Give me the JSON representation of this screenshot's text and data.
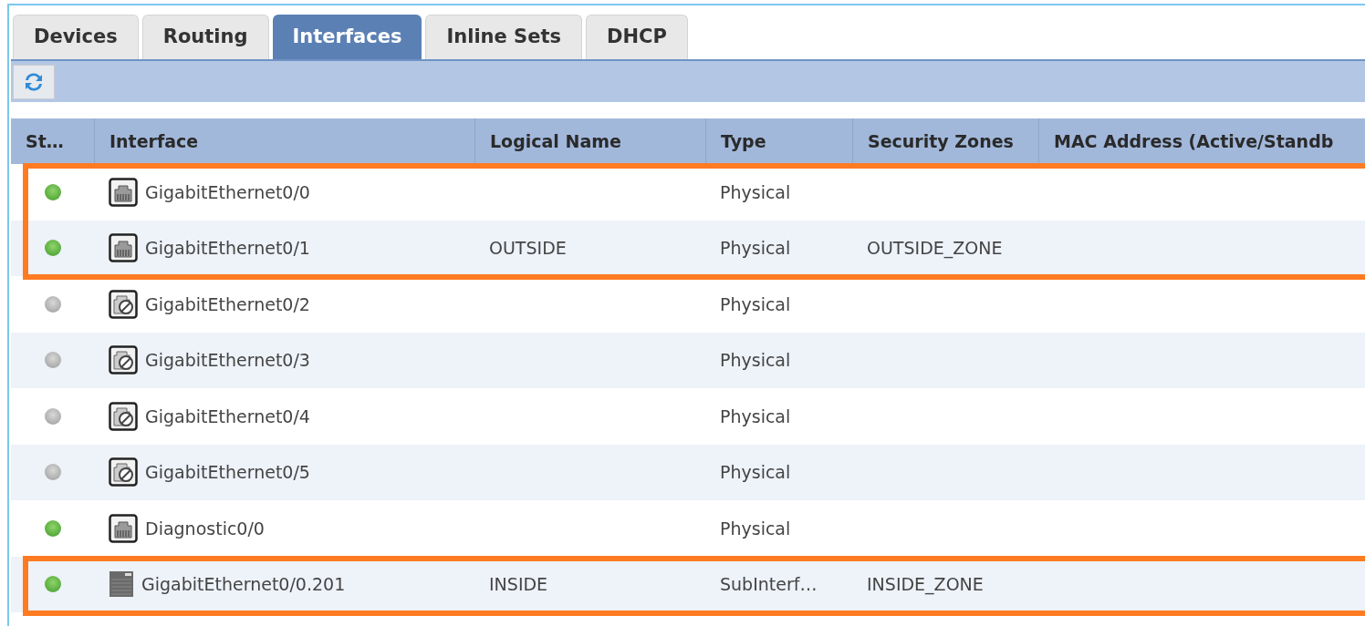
{
  "tabs": [
    {
      "label": "Devices",
      "selected": false
    },
    {
      "label": "Routing",
      "selected": false
    },
    {
      "label": "Interfaces",
      "selected": true
    },
    {
      "label": "Inline Sets",
      "selected": false
    },
    {
      "label": "DHCP",
      "selected": false
    }
  ],
  "table": {
    "columns": [
      "St…",
      "Interface",
      "Logical Name",
      "Type",
      "Security Zones",
      "MAC Address (Active/Standb"
    ],
    "rows": [
      {
        "up": true,
        "kind": "port",
        "interface": "GigabitEthernet0/0",
        "logical_name": "",
        "type": "Physical",
        "security_zone": "",
        "highlighted": true
      },
      {
        "up": true,
        "kind": "port",
        "interface": "GigabitEthernet0/1",
        "logical_name": "OUTSIDE",
        "type": "Physical",
        "security_zone": "OUTSIDE_ZONE",
        "highlighted": true
      },
      {
        "up": false,
        "kind": "disabled-port",
        "interface": "GigabitEthernet0/2",
        "logical_name": "",
        "type": "Physical",
        "security_zone": "",
        "highlighted": false
      },
      {
        "up": false,
        "kind": "disabled-port",
        "interface": "GigabitEthernet0/3",
        "logical_name": "",
        "type": "Physical",
        "security_zone": "",
        "highlighted": false
      },
      {
        "up": false,
        "kind": "disabled-port",
        "interface": "GigabitEthernet0/4",
        "logical_name": "",
        "type": "Physical",
        "security_zone": "",
        "highlighted": false
      },
      {
        "up": false,
        "kind": "disabled-port",
        "interface": "GigabitEthernet0/5",
        "logical_name": "",
        "type": "Physical",
        "security_zone": "",
        "highlighted": false
      },
      {
        "up": true,
        "kind": "port",
        "interface": "Diagnostic0/0",
        "logical_name": "",
        "type": "Physical",
        "security_zone": "",
        "highlighted": false
      },
      {
        "up": true,
        "kind": "subinterface",
        "interface": "GigabitEthernet0/0.201",
        "logical_name": "INSIDE",
        "type": "SubInterf…",
        "security_zone": "INSIDE_ZONE",
        "highlighted": true
      }
    ]
  }
}
